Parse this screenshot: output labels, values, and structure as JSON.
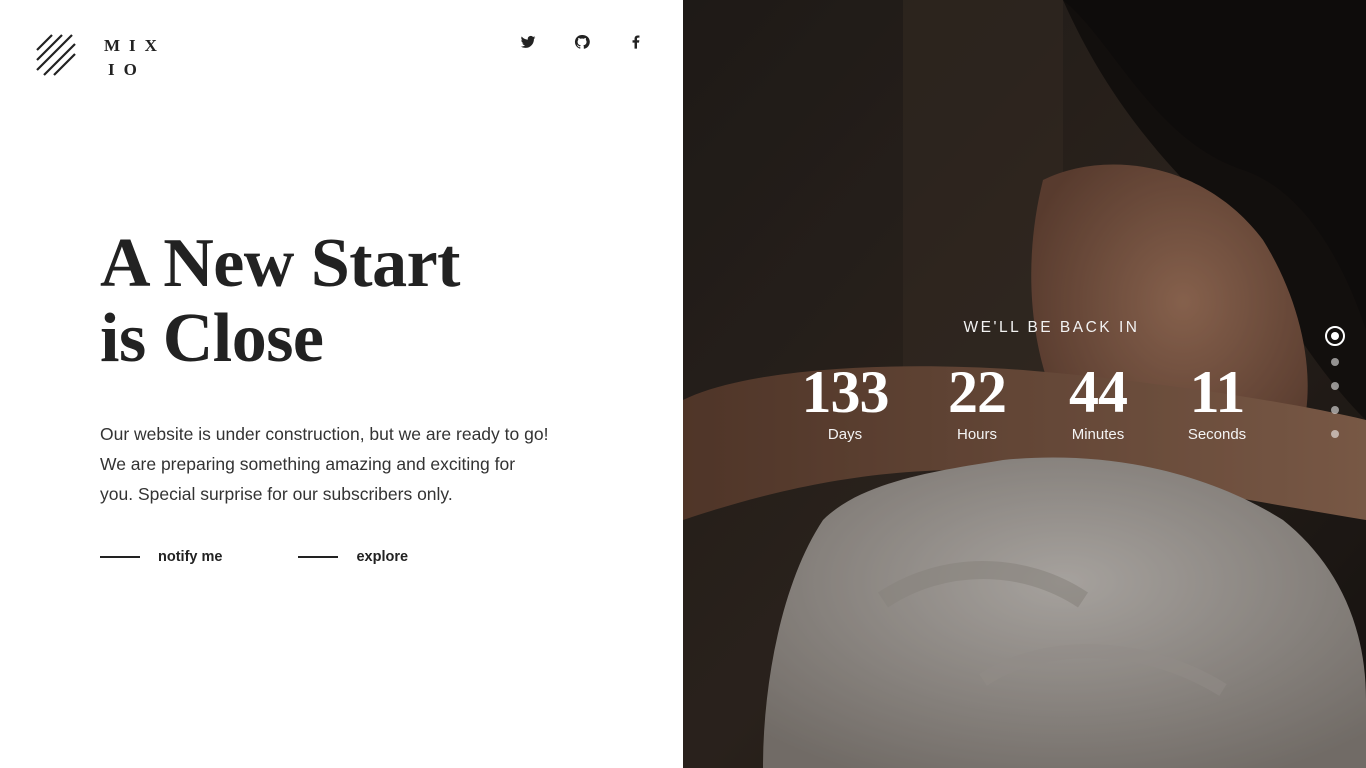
{
  "brand": {
    "line1": "MIX",
    "line2": "IO"
  },
  "socials": [
    {
      "name": "twitter"
    },
    {
      "name": "github"
    },
    {
      "name": "facebook"
    }
  ],
  "hero": {
    "headline": [
      "A New Start",
      "is Close"
    ],
    "intro": [
      "Our website is under construction, but we are ready to go!",
      "We are preparing something amazing and exciting for",
      "you. Special surprise for our subscribers only."
    ],
    "actions": [
      {
        "label": "notify me"
      },
      {
        "label": "explore"
      }
    ]
  },
  "countdown": {
    "heading": "WE'LL BE BACK IN",
    "units": [
      {
        "value": "133",
        "caption": "Days"
      },
      {
        "value": "22",
        "caption": "Hours"
      },
      {
        "value": "44",
        "caption": "Minutes"
      },
      {
        "value": "11",
        "caption": "Seconds"
      }
    ]
  },
  "slider": {
    "count": 5,
    "active_index": 0
  },
  "colors": {
    "text_dark": "#222222",
    "panel_bg": "#ffffff",
    "overlay_text": "#ffffff"
  }
}
